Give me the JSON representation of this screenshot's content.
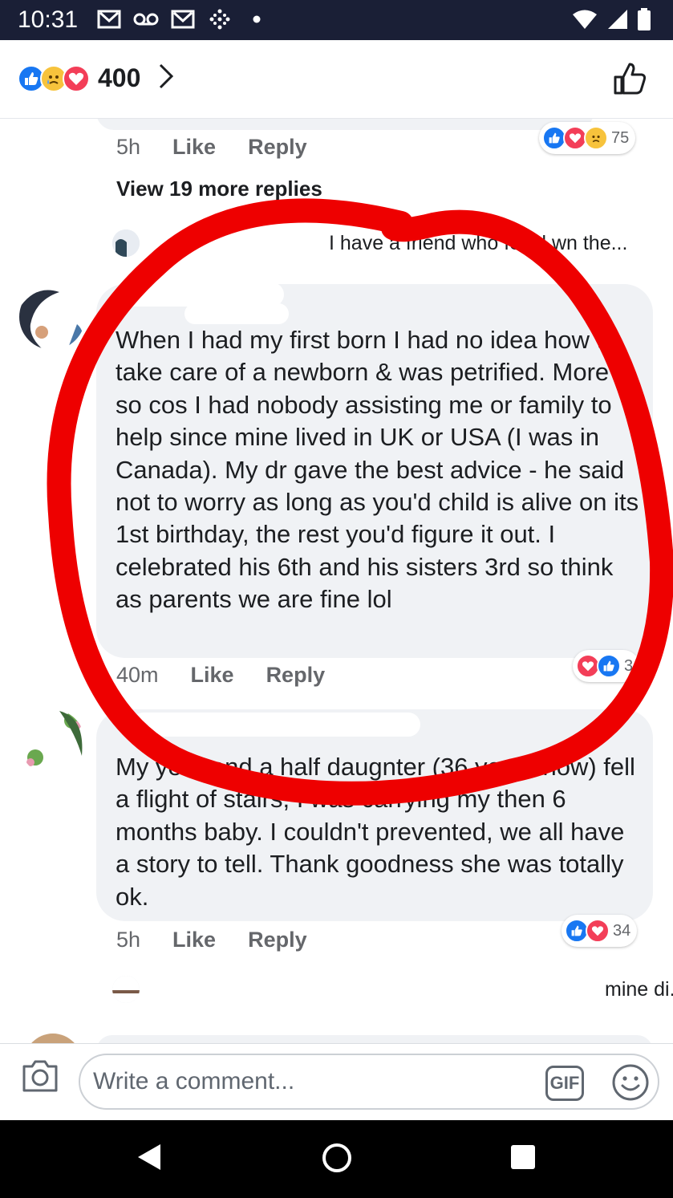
{
  "status_bar": {
    "time": "10:31"
  },
  "header": {
    "reaction_count": "400"
  },
  "comments": [
    {
      "meta": {
        "time": "5h",
        "like": "Like",
        "reply": "Reply"
      },
      "reactions": {
        "count": "75",
        "types": [
          "like",
          "love",
          "sad"
        ]
      },
      "view_more": "View 19 more replies",
      "reply_preview": "I have a friend who fell d  wn the..."
    },
    {
      "text": "When I had my first born I had no idea how to take care of a newborn & was petrified. More so cos I had nobody assisting me or family to help since mine lived in UK or USA (I was in Canada). My dr gave the best advice - he said not to worry as long as you'd child is alive on its 1st birthday, the rest you'd figure it out. I celebrated his 6th and his sisters 3rd so think as parents we are fine lol",
      "meta": {
        "time": "40m",
        "like": "Like",
        "reply": "Reply"
      },
      "reactions": {
        "count": "3",
        "types": [
          "love",
          "like"
        ]
      }
    },
    {
      "text": "My year and a half daugnter (36 years now) fell a flight of stairs, I was carrying my then 6 months baby. I couldn't prevented, we all have a story to tell. Thank goodness she was totally ok.",
      "meta": {
        "time": "5h",
        "like": "Like",
        "reply": "Reply"
      },
      "reactions": {
        "count": "34",
        "types": [
          "like",
          "love"
        ]
      },
      "reply_preview": "mine di..."
    }
  ],
  "composer": {
    "placeholder": "Write a comment...",
    "gif_label": "GIF"
  },
  "colors": {
    "brand_blue": "#1877f2",
    "love_red": "#f33e58",
    "annotation_red": "#ee0000"
  }
}
